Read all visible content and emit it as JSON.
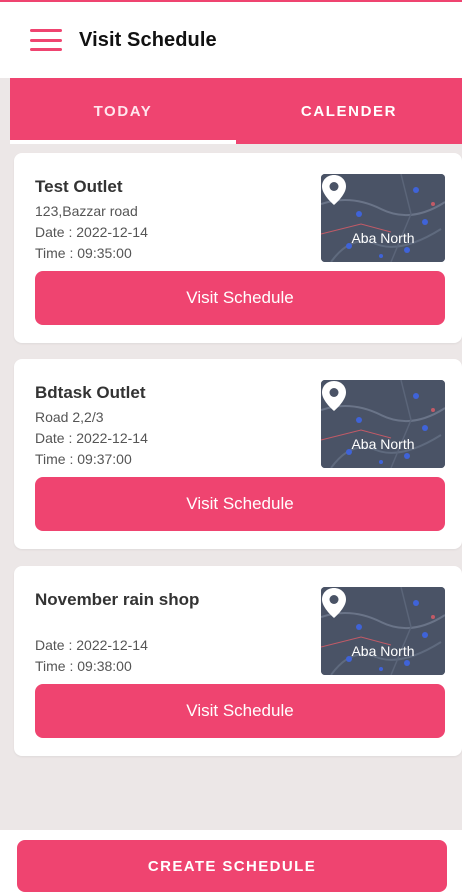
{
  "header": {
    "title": "Visit Schedule",
    "menu_icon": "hamburger-menu-icon"
  },
  "tabs": [
    {
      "label": "TODAY",
      "active": true
    },
    {
      "label": "CALENDER",
      "active": false
    }
  ],
  "schedules": [
    {
      "name": "Test Outlet",
      "address": "123,Bazzar road",
      "date": "Date : 2022-12-14",
      "time": "Time : 09:35:00",
      "map_label": "Aba North",
      "button": "Visit Schedule"
    },
    {
      "name": "Bdtask Outlet",
      "address": "Road 2,2/3",
      "date": "Date : 2022-12-14",
      "time": "Time : 09:37:00",
      "map_label": "Aba North",
      "button": "Visit Schedule"
    },
    {
      "name": "November rain shop",
      "address": "",
      "date": "Date : 2022-12-14",
      "time": "Time : 09:38:00",
      "map_label": "Aba North",
      "button": "Visit Schedule"
    }
  ],
  "footer": {
    "create_label": "CREATE SCHEDULE"
  },
  "colors": {
    "accent": "#ef4470",
    "background": "#ece7e7",
    "map": "#4a5366"
  }
}
